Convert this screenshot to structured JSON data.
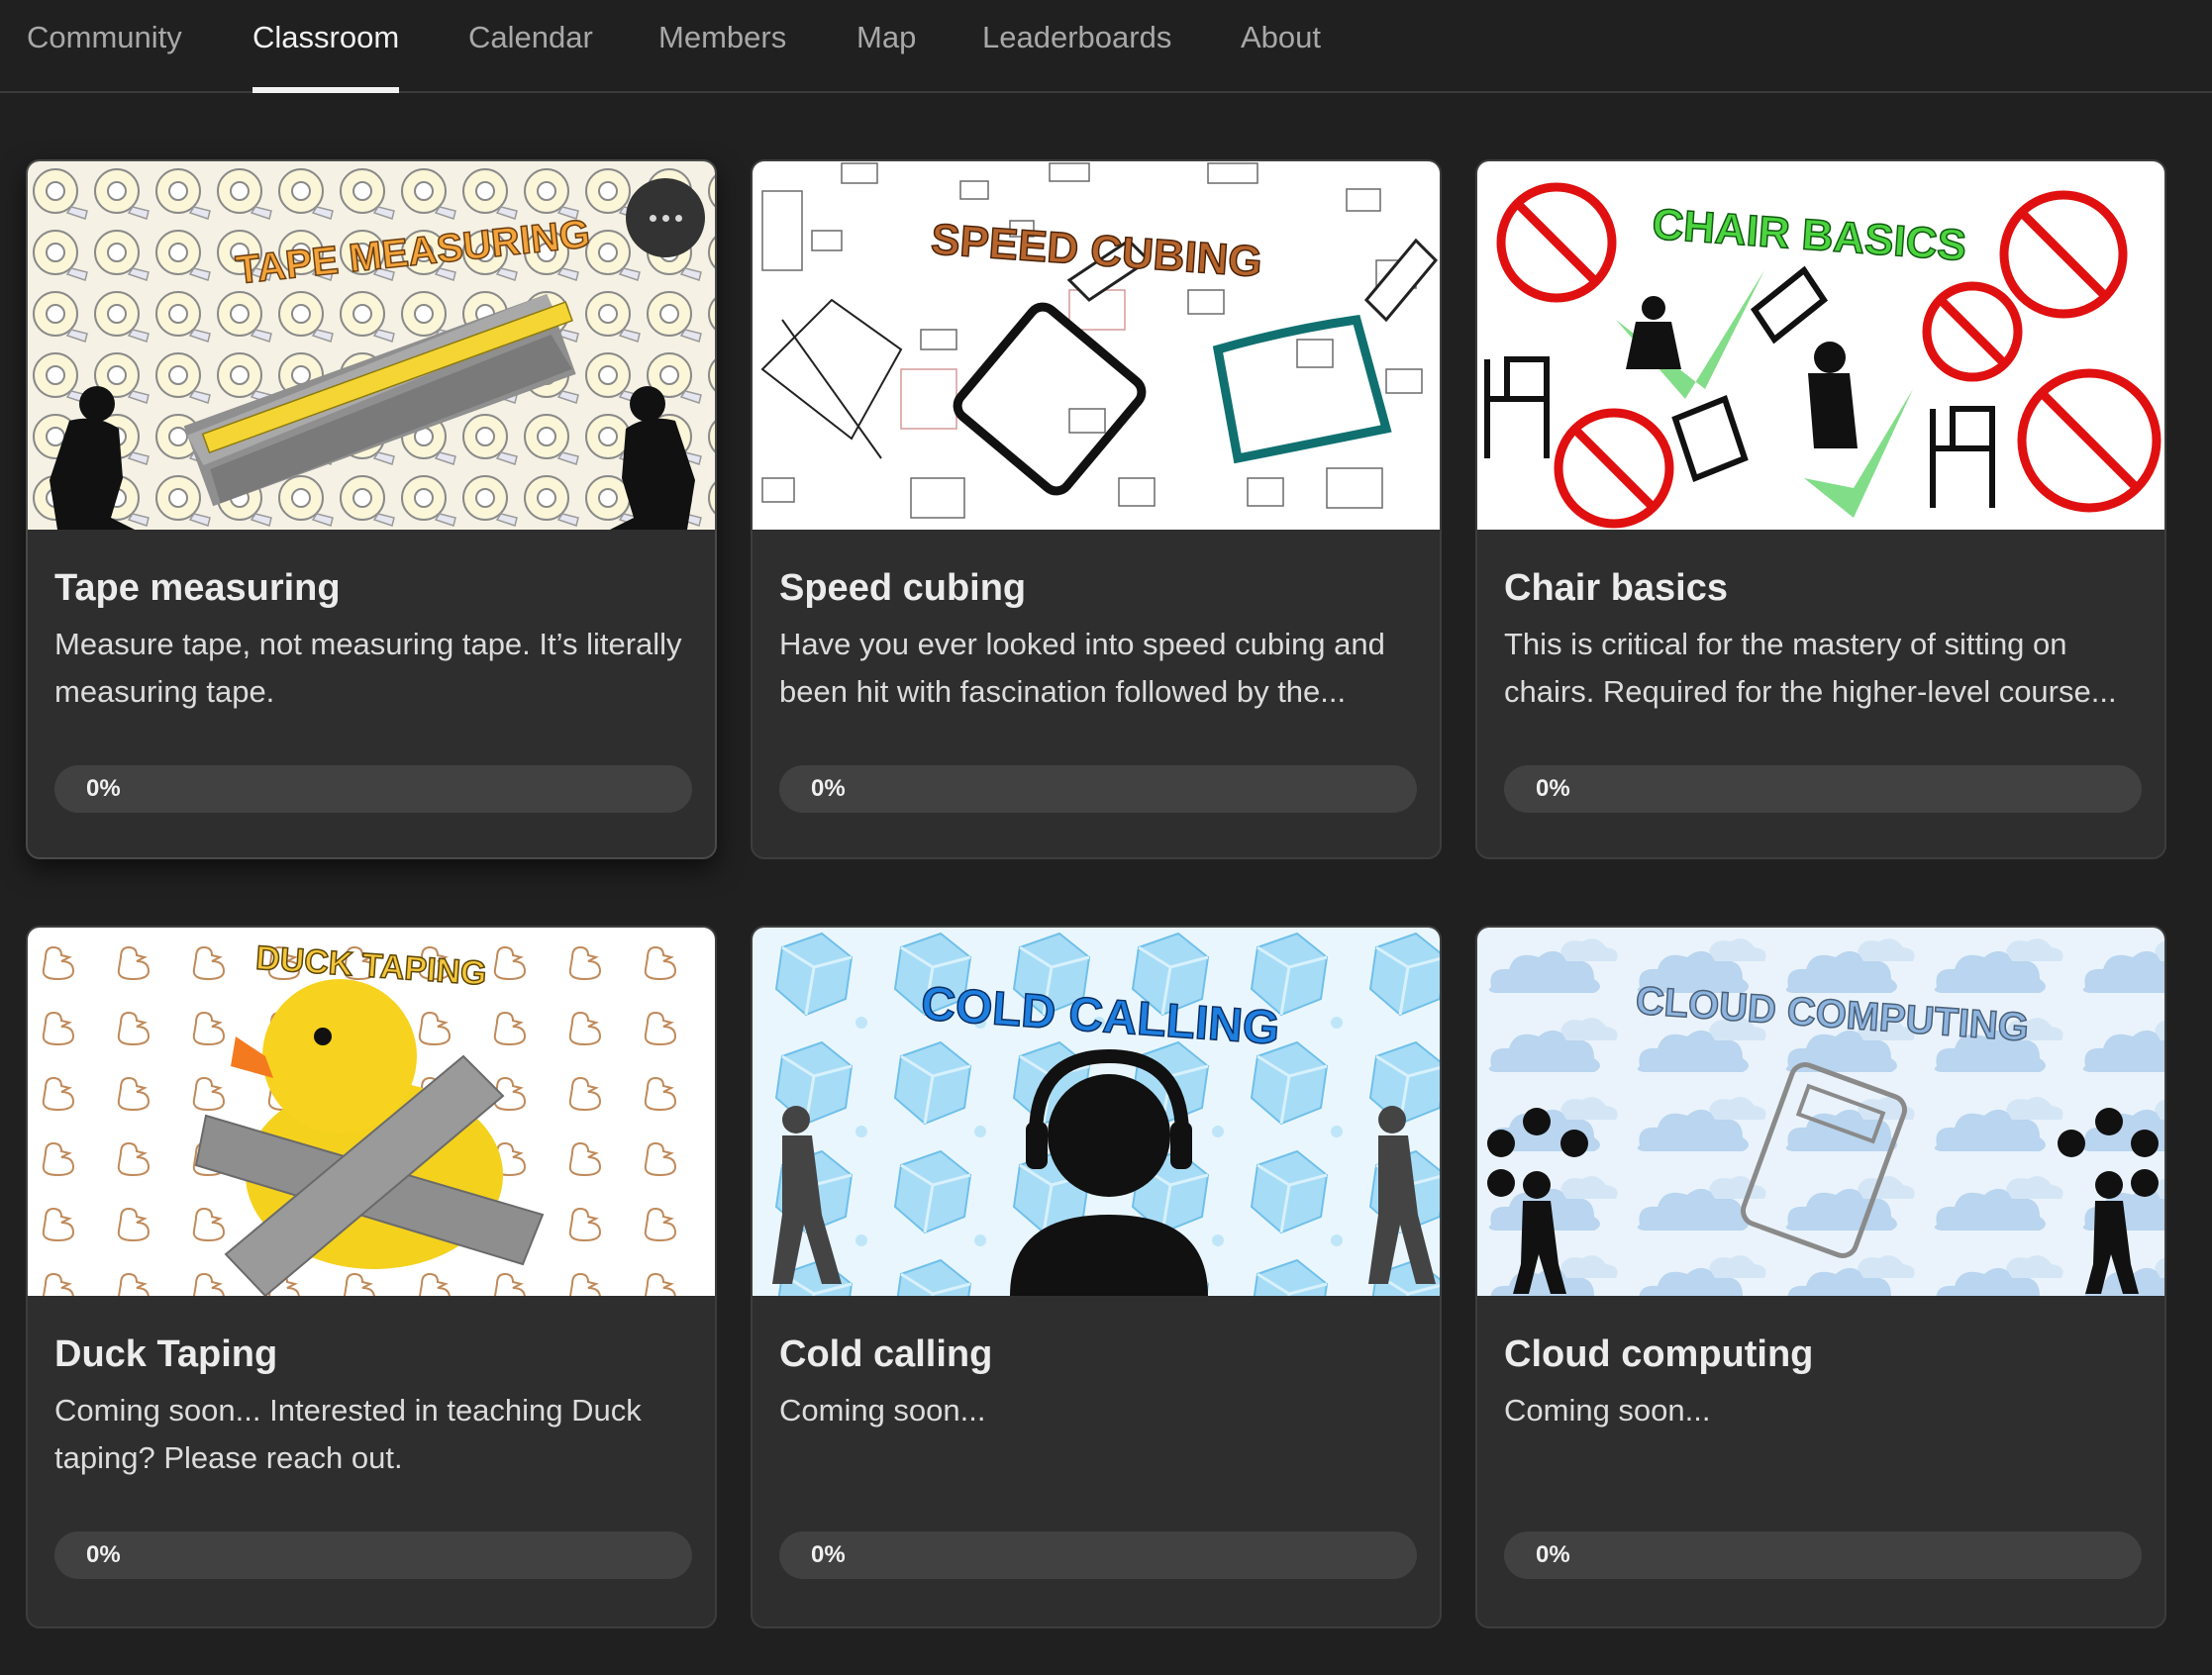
{
  "nav": {
    "tabs": [
      {
        "label": "Community"
      },
      {
        "label": "Classroom"
      },
      {
        "label": "Calendar"
      },
      {
        "label": "Members"
      },
      {
        "label": "Map"
      },
      {
        "label": "Leaderboards"
      },
      {
        "label": "About"
      }
    ],
    "active": "Classroom"
  },
  "courses": [
    {
      "title": "Tape measuring",
      "description": "Measure tape, not measuring tape. It’s literally measuring tape.",
      "banner": "TAPE MEASURING",
      "progress_label": "0%",
      "progress": 0
    },
    {
      "title": "Speed cubing",
      "description": "Have you ever looked into speed cubing and been hit with fascination followed by the...",
      "banner": "SPEED CUBING",
      "progress_label": "0%",
      "progress": 0
    },
    {
      "title": "Chair basics",
      "description": "This is critical for the mastery of sitting on chairs. Required for the higher-level course...",
      "banner": "CHAIR BASICS",
      "progress_label": "0%",
      "progress": 0
    },
    {
      "title": "Duck Taping",
      "description": "Coming soon... Interested in teaching Duck taping? Please reach out.",
      "banner": "DUCK TAPING",
      "progress_label": "0%",
      "progress": 0
    },
    {
      "title": "Cold calling",
      "description": "Coming soon...",
      "banner": "COLD CALLING",
      "progress_label": "0%",
      "progress": 0
    },
    {
      "title": "Cloud computing",
      "description": "Coming soon...",
      "banner": "CLOUD COMPUTING",
      "progress_label": "0%",
      "progress": 0
    }
  ],
  "colors": {
    "background": "#202020",
    "card": "#2e2e2e",
    "progress_track": "#414141",
    "tape_banner": "#f2a33a",
    "speed_banner": "#b7652d",
    "chair_banner": "#4cd43f",
    "duck_banner": "#f3c63a",
    "cold_banner": "#1e7fe0",
    "cloud_banner": "#8db4de"
  },
  "icons": {
    "more": "more-options-icon"
  }
}
